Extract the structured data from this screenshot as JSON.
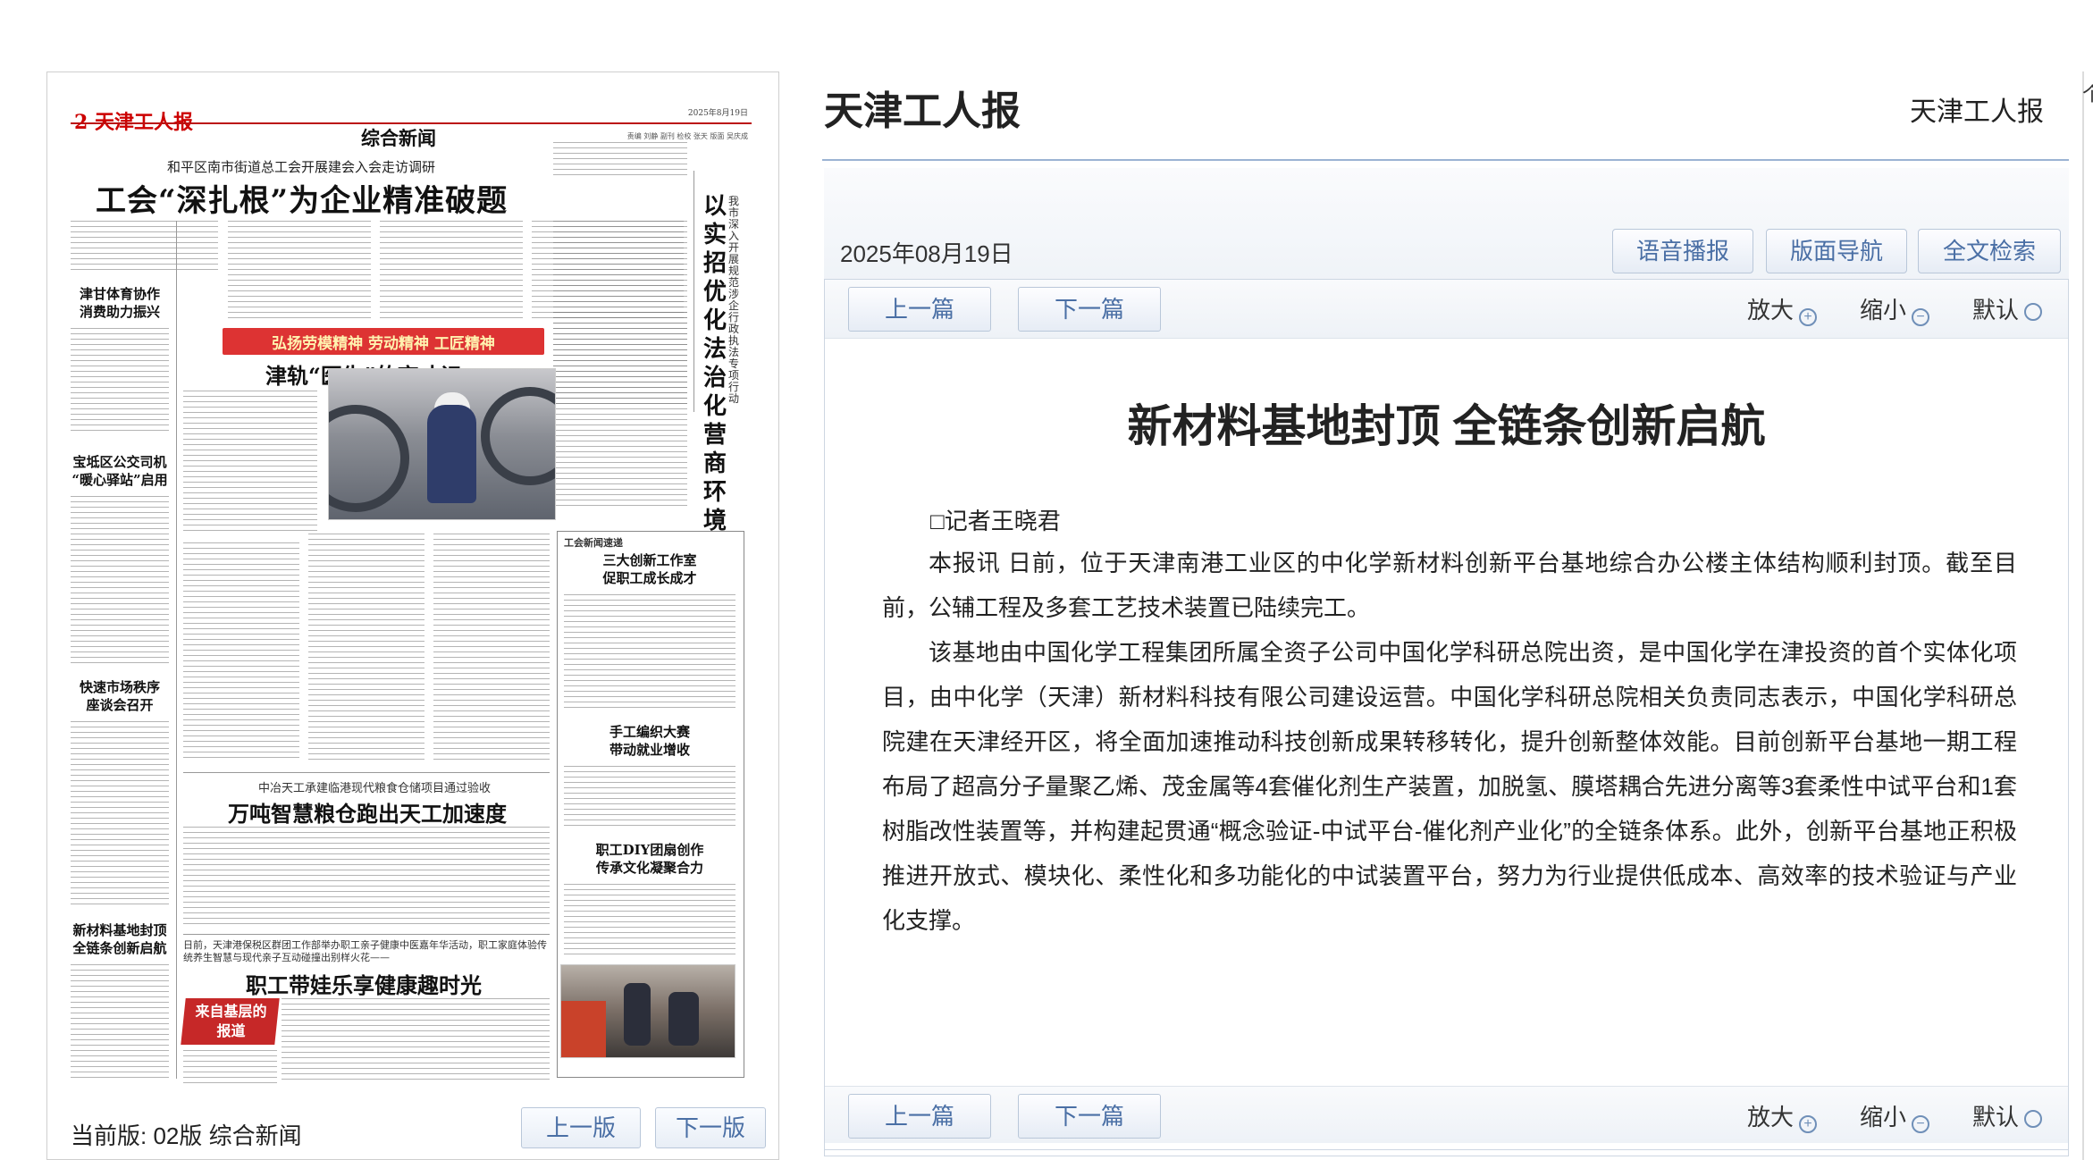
{
  "newspaper": {
    "masthead": "2 天津工人报",
    "date_small": "2025年8月19日",
    "section": "综合新闻",
    "authors_small": "责编 刘静 副刊 检校 张天 版面 吴庆成",
    "lead": {
      "subtitle": "和平区南市街道总工会开展建会入会走访调研",
      "headline": "工会“深扎根”为企业精准破题"
    },
    "vertical_title": "以实招优化法治化营商环境",
    "vertical_sub": "我市深入开展规范涉企行政执法专项行动",
    "side_stories": [
      "津甘体育协作\n消费助力振兴",
      "宝坻区公交司机\n“暖心驿站”启用",
      "快速市场秩序\n座谈会召开",
      "新材料基地封顶\n全链条创新启航"
    ],
    "banner": "弘扬劳模精神 劳动精神 工匠精神",
    "feature_headline": "津轨“医生”的育才记",
    "column_label": "工会新闻速递",
    "box_stories": [
      "三大创新工作室\n促职工成长成才",
      "手工编织大赛\n带动就业增收",
      "职工DIY团扇创作\n传承文化凝聚合力"
    ],
    "grain": {
      "subtitle": "中冶天工承建临港现代粮食仓储项目通过验收",
      "headline": "万吨智慧粮仓跑出天工加速度"
    },
    "child": {
      "subtitle": "日前，天津港保税区群团工作部举办职工亲子健康中医嘉年华活动，职工家庭体验传统养生智慧与现代亲子互动碰撞出别样火花——",
      "headline": "职工带娃乐享健康趣时光"
    },
    "grassroots_tag": "来自基层的报道",
    "footer": {
      "current": "当前版: 02版 综合新闻",
      "prev": "上一版",
      "next": "下一版"
    }
  },
  "viewer": {
    "site_title": "天津工人报",
    "site_title_right": "天津工人报",
    "date": "2025年08月19日",
    "header_buttons": [
      "语音播报",
      "版面导航",
      "全文检索"
    ],
    "prev_article": "上一篇",
    "next_article": "下一篇",
    "zoom_in": "放大",
    "zoom_out": "缩小",
    "zoom_default": "默认",
    "article": {
      "title": "新材料基地封顶 全链条创新启航",
      "byline": "□记者王晓君",
      "paragraphs": [
        "本报讯 日前，位于天津南港工业区的中化学新材料创新平台基地综合办公楼主体结构顺利封顶。截至目前，公辅工程及多套工艺技术装置已陆续完工。",
        "该基地由中国化学工程集团所属全资子公司中国化学科研总院出资，是中国化学在津投资的首个实体化项目，由中化学（天津）新材料科技有限公司建设运营。中国化学科研总院相关负责同志表示，中国化学科研总院建在天津经开区，将全面加速推动科技创新成果转移转化，提升创新整体效能。目前创新平台基地一期工程布局了超高分子量聚乙烯、茂金属等4套催化剂生产装置，加脱氢、膜塔耦合先进分离等3套柔性中试平台和1套树脂改性装置等，并构建起贯通“概念验证-中试平台-催化剂产业化”的全链条体系。此外，创新平台基地正积极推进开放式、模块化、柔性化和多功能化的中试装置平台，努力为行业提供低成本、高效率的技术验证与产业化支撑。"
      ]
    },
    "edge_glyph": "个"
  }
}
